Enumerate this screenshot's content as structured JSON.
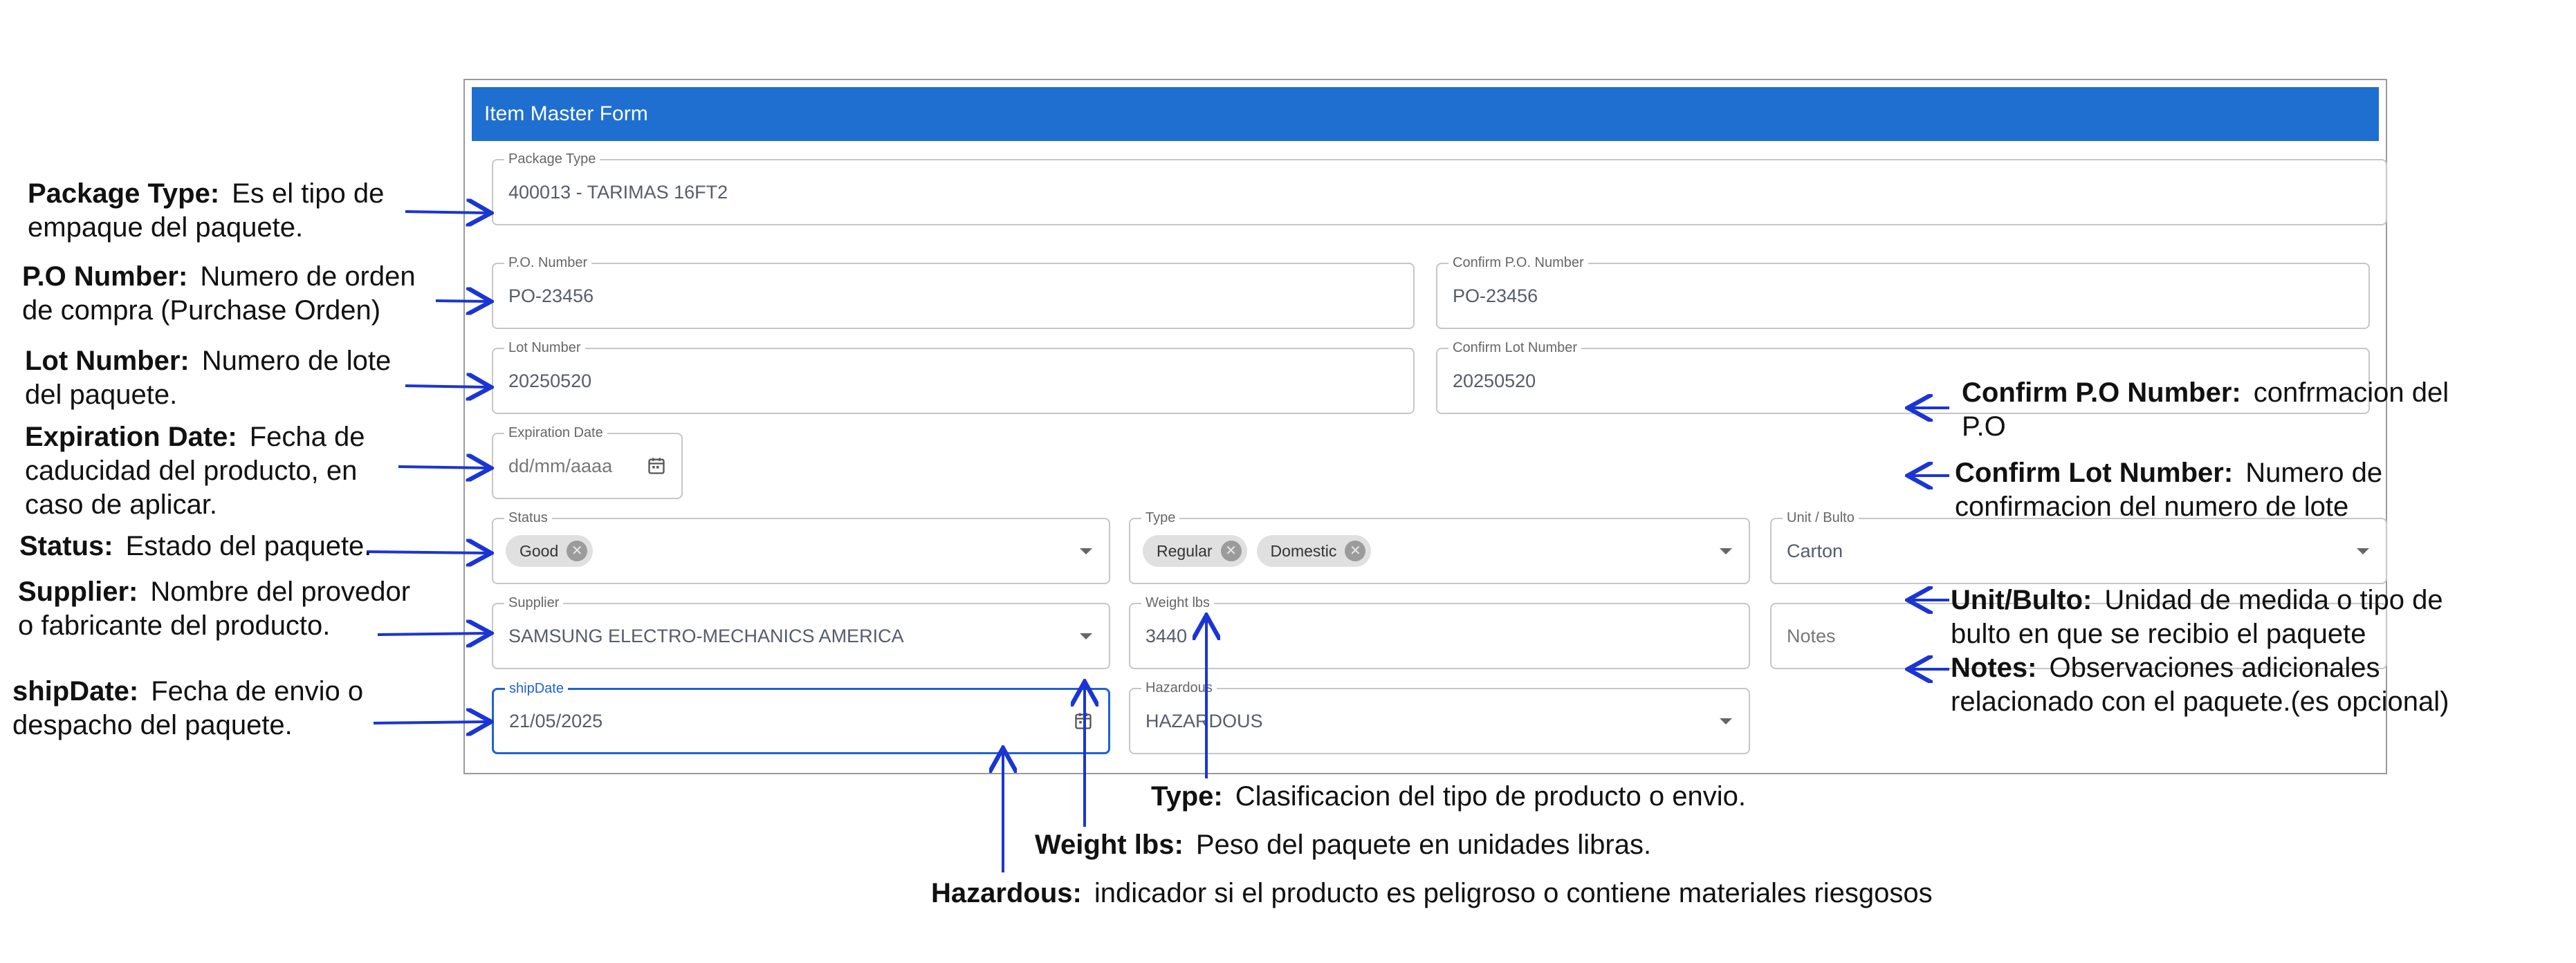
{
  "form": {
    "title": "Item Master Form",
    "package_type": {
      "label": "Package Type",
      "value": "400013 - TARIMAS 16FT2"
    },
    "po_number": {
      "label": "P.O. Number",
      "value": "PO-23456"
    },
    "confirm_po_number": {
      "label": "Confirm P.O. Number",
      "value": "PO-23456"
    },
    "lot_number": {
      "label": "Lot Number",
      "value": "20250520"
    },
    "confirm_lot_number": {
      "label": "Confirm Lot Number",
      "value": "20250520"
    },
    "expiration_date": {
      "label": "Expiration Date",
      "value": "dd/mm/aaaa",
      "icon": "calendar-icon"
    },
    "status": {
      "label": "Status",
      "chips": [
        "Good"
      ]
    },
    "type": {
      "label": "Type",
      "chips": [
        "Regular",
        "Domestic"
      ]
    },
    "unit_bulto": {
      "label": "Unit / Bulto",
      "value": "Carton"
    },
    "supplier": {
      "label": "Supplier",
      "value": "SAMSUNG ELECTRO-MECHANICS AMERICA"
    },
    "weight_lbs": {
      "label": "Weight lbs",
      "value": "3440"
    },
    "notes": {
      "placeholder": "Notes"
    },
    "ship_date": {
      "label": "shipDate",
      "value": "21/05/2025",
      "icon": "calendar-icon"
    },
    "hazardous": {
      "label": "Hazardous",
      "value": "HAZARDOUS"
    }
  },
  "annotations": {
    "package_type": {
      "term": "Package Type:",
      "line1": "Es el tipo de",
      "line2": "empaque del paquete."
    },
    "po_number": {
      "term": "P.O  Number:",
      "line1": "Numero de orden",
      "line2": "de compra (Purchase Orden)"
    },
    "lot_number": {
      "term": "Lot Number:",
      "line1": "Numero de lote",
      "line2": "del paquete."
    },
    "expiration_date": {
      "term": "Expiration Date:",
      "line1": "Fecha de",
      "line2": "caducidad del producto, en",
      "line3": "caso de aplicar."
    },
    "status": {
      "term": "Status:",
      "line1": "Estado del paquete."
    },
    "supplier": {
      "term": "Supplier:",
      "line1": "Nombre del provedor",
      "line2": "o fabricante del producto."
    },
    "ship_date": {
      "term": "shipDate:",
      "line1": "Fecha de envio o",
      "line2": "despacho del paquete."
    },
    "confirm_po": {
      "term": "Confirm P.O  Number:",
      "line1": "confrmacion del",
      "line2": "P.O"
    },
    "confirm_lot": {
      "term": "Confirm Lot  Number:",
      "line1": "Numero de",
      "line2": "confirmacion  del numero de lote"
    },
    "unit_bulto": {
      "term": "Unit/Bulto:",
      "line1": "Unidad de medida  o tipo de",
      "line2": "bulto en que se  recibio el paquete"
    },
    "notes": {
      "term": "Notes:",
      "line1": "Observaciones adicionales",
      "line2": "relacionado con el paquete.(es opcional)"
    },
    "type": {
      "term": "Type:",
      "line1": "Clasificacion del tipo de producto o envio."
    },
    "weight": {
      "term": "Weight lbs:",
      "line1": "Peso del paquete en unidades libras."
    },
    "hazardous": {
      "term": "Hazardous:",
      "line1": "indicador si el producto es peligroso o contiene materiales riesgosos"
    }
  },
  "colors": {
    "header": "#1f6fd0",
    "arrow": "#1a35d4",
    "focus": "#1f63d0"
  }
}
